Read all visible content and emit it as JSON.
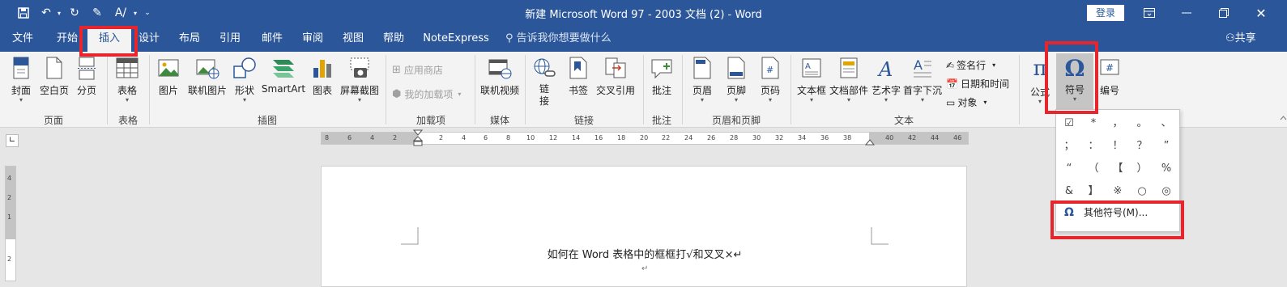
{
  "window": {
    "title": "新建 Microsoft Word 97 - 2003 文档 (2)  -  Word",
    "login": "登录"
  },
  "tabs": [
    "文件",
    "开始",
    "插入",
    "设计",
    "布局",
    "引用",
    "邮件",
    "审阅",
    "视图",
    "帮助",
    "NoteExpress"
  ],
  "active_tab": "插入",
  "tellme": "告诉我你想要做什么",
  "share": "共享",
  "ribbon": {
    "pages": {
      "cover": "封面",
      "blank": "空白页",
      "break": "分页",
      "label": "页面"
    },
    "tables": {
      "table": "表格",
      "label": "表格"
    },
    "illustrations": {
      "pictures": "图片",
      "online_pictures": "联机图片",
      "shapes": "形状",
      "smartart": "SmartArt",
      "chart": "图表",
      "screenshot": "屏幕截图",
      "label": "插图"
    },
    "addins": {
      "store": "应用商店",
      "my_addins": "我的加载项",
      "label": "加载项"
    },
    "media": {
      "online_video": "联机视频",
      "label": "媒体"
    },
    "links": {
      "link_1": "链",
      "link_2": "接",
      "bookmark": "书签",
      "cross_ref": "交叉引用",
      "label": "链接"
    },
    "comments": {
      "comment": "批注",
      "label": "批注"
    },
    "header_footer": {
      "header": "页眉",
      "footer": "页脚",
      "page_number": "页码",
      "label": "页眉和页脚"
    },
    "text": {
      "textbox": "文本框",
      "quick_parts": "文档部件",
      "wordart": "艺术字",
      "dropcap": "首字下沉",
      "signature": "签名行",
      "datetime": "日期和时间",
      "object": "对象",
      "label": "文本"
    },
    "symbols": {
      "equation": "公式",
      "symbol": "符号",
      "numbering": "编号"
    }
  },
  "ruler": {
    "ticks": [
      "8",
      "6",
      "4",
      "2",
      "2",
      "4",
      "6",
      "8",
      "10",
      "12",
      "14",
      "16",
      "18",
      "20",
      "22",
      "24",
      "26",
      "28",
      "30",
      "32",
      "34",
      "36",
      "38",
      "40",
      "42",
      "44",
      "46",
      "48"
    ],
    "vticks": [
      "4",
      "2",
      "1",
      "2"
    ]
  },
  "document": {
    "line1": "如何在 Word  表格中的框框打√和叉叉×↵",
    "para_mark": "↵"
  },
  "symbol_dropdown": {
    "symbols": [
      "☑",
      "*",
      "，",
      "。",
      "、",
      "；",
      "：",
      "！",
      "？",
      "”",
      "“",
      "（",
      "【",
      "）",
      "%",
      "&",
      "】",
      "※",
      "○",
      "◎"
    ],
    "more": "其他符号(M)..."
  },
  "icons": {
    "omega": "Ω",
    "equation_pi": "π",
    "numbering_hash": "#",
    "person": "person-icon",
    "search": "search-icon"
  },
  "colors": {
    "accent": "#2b579a",
    "highlight": "#e8242c"
  }
}
